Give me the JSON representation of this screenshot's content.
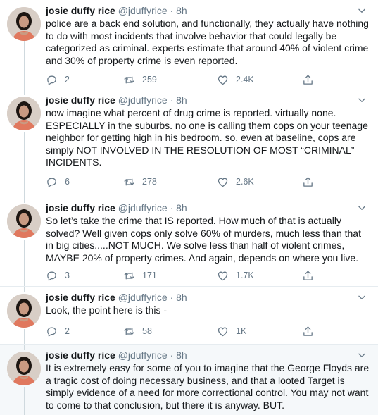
{
  "colors": {
    "text": "#14171a",
    "muted": "#657786",
    "divider": "#e6ecf0",
    "highlight": "#f5f8fa"
  },
  "author": {
    "name": "josie duffy rice",
    "handle": "@jduffyrice",
    "separator": "·",
    "time": "8h"
  },
  "tweets": [
    {
      "text": "police are a back end solution, and functionally, they actually have nothing to do with most incidents that involve behavior that could legally be categorized as criminal. experts estimate that around 40% of violent crime and 30% of property crime is even reported.",
      "replies": "2",
      "retweets": "259",
      "likes": "2.4K"
    },
    {
      "text": "now imagine what percent of drug crime is reported. virtually none. ESPECIALLY in the suburbs. no one is calling them cops on your teenage neighbor for getting high in his bedroom. so, even at baseline, cops are simply NOT INVOLVED IN THE RESOLUTION OF MOST “CRIMINAL” INCIDENTS.",
      "replies": "6",
      "retweets": "278",
      "likes": "2.6K"
    },
    {
      "text": "So let’s take the crime that IS reported. How much of that is actually solved? Well given cops only solve 60% of murders, much less than that in big cities.....NOT MUCH. We solve less than half of violent crimes, MAYBE 20% of property crimes. And again, depends on where you live.",
      "replies": "3",
      "retweets": "171",
      "likes": "1.7K"
    },
    {
      "text": "Look, the point here is this -",
      "replies": "2",
      "retweets": "58",
      "likes": "1K"
    },
    {
      "text": "It is extremely easy for some of you to imagine that the George Floyds are a tragic cost of doing necessary business, and that a looted Target is simply evidence of a need for more correctional control. You may not want to come to that conclusion, but there it is anyway. BUT."
    }
  ]
}
